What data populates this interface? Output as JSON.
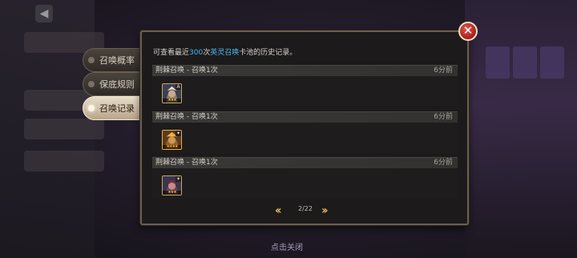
{
  "side_tabs": [
    {
      "label": "召唤概率",
      "active": false
    },
    {
      "label": "保底规则",
      "active": false
    },
    {
      "label": "召唤记录",
      "active": true
    }
  ],
  "info": {
    "prefix": "可查看最近",
    "count": "300",
    "mid": "次",
    "pool": "英灵召唤",
    "suffix": "卡池的历史记录。"
  },
  "records": [
    {
      "title": "荆棘召唤 - 召唤1次",
      "time": "6分前",
      "hero": {
        "badge": "A",
        "stars": "★★★",
        "skin": "#c9aa90",
        "frame": "#c8a85a"
      }
    },
    {
      "title": "荆棘召唤 - 召唤1次",
      "time": "6分前",
      "hero": {
        "badge": "✦",
        "stars": "★★★★",
        "skin": "#c89a55",
        "frame": "#f0b43a"
      }
    },
    {
      "title": "荆棘召唤 - 召唤1次",
      "time": "6分前",
      "hero": {
        "badge": "✦",
        "stars": "★★★",
        "skin": "#c98a86",
        "frame": "#c8a85a"
      }
    }
  ],
  "pagination": {
    "current": "2/22"
  },
  "bottom_close": "点击关闭",
  "colors": {
    "accent_blue": "#49b8f2",
    "panel_border": "#6b5f4d",
    "arrow_gold": "#e2b454",
    "close_red": "#c1302b"
  },
  "icons": {
    "close": "close-icon",
    "prev": "double-chevron-left-icon",
    "next": "double-chevron-right-icon"
  }
}
